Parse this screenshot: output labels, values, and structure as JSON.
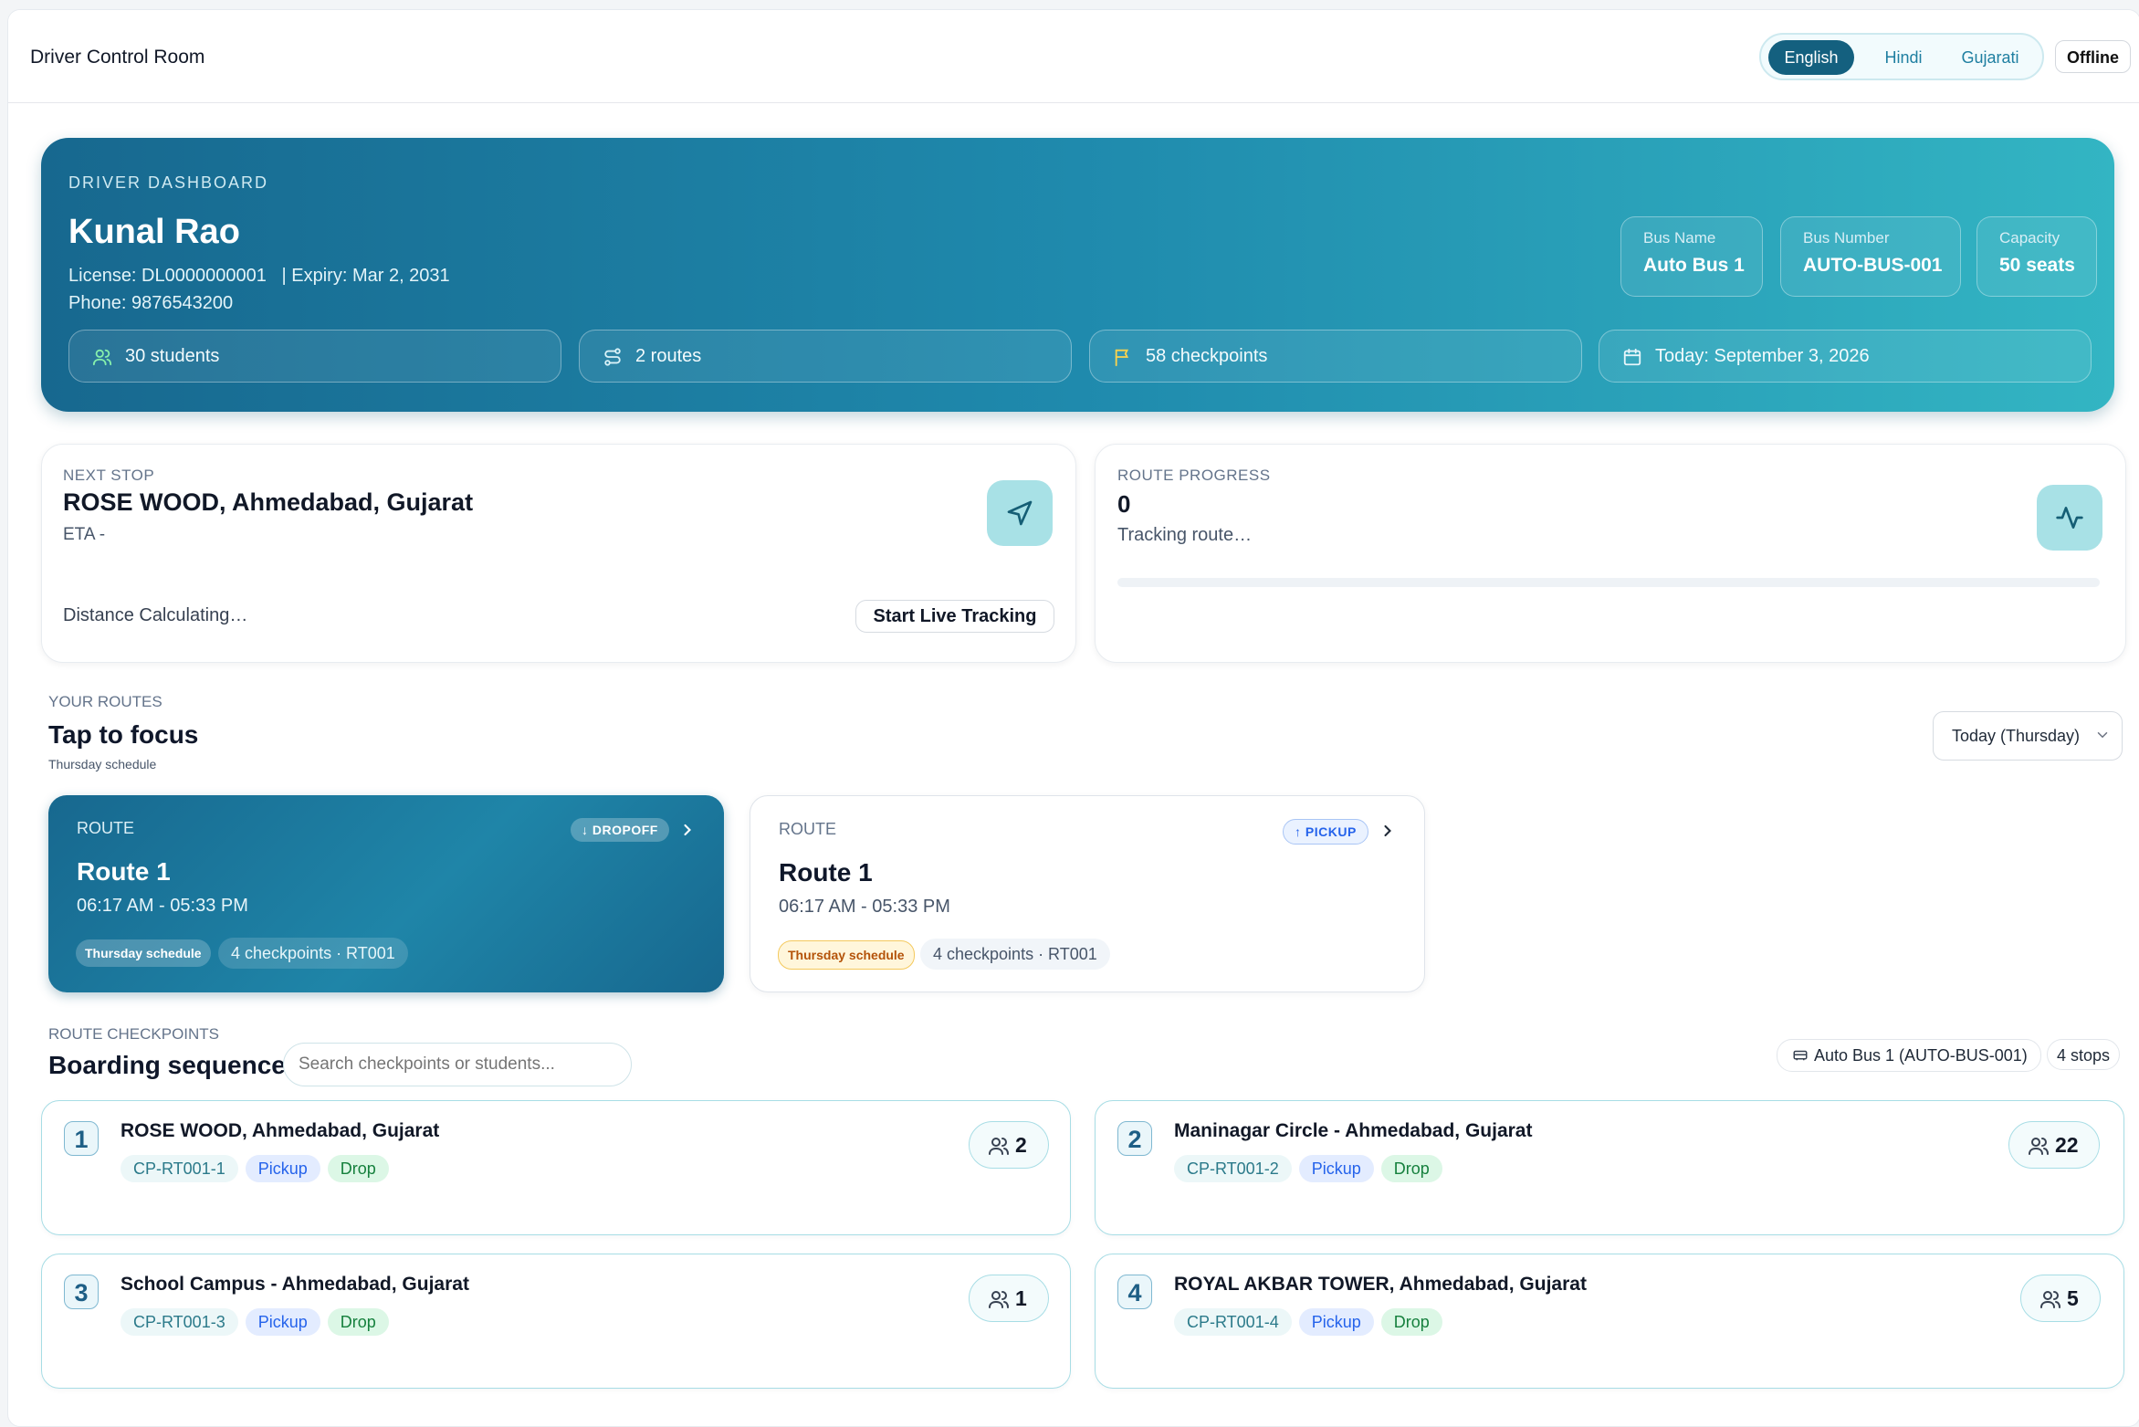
{
  "app": {
    "title": "Driver Control Room"
  },
  "languages": {
    "options": [
      "English",
      "Hindi",
      "Gujarati"
    ],
    "selected": "English"
  },
  "status": {
    "connection": "Offline"
  },
  "driver": {
    "eyebrow": "DRIVER DASHBOARD",
    "name": "Kunal Rao",
    "license_line": "License: DL0000000001   | Expiry: Mar 2, 2031",
    "phone_line": "Phone: 9876543200"
  },
  "bus": {
    "name_label": "Bus Name",
    "name": "Auto Bus 1",
    "number_label": "Bus Number",
    "number": "AUTO-BUS-001",
    "capacity_label": "Capacity",
    "capacity": "50 seats"
  },
  "stats": {
    "students": "30 students",
    "routes": "2 routes",
    "checkpoints": "58 checkpoints",
    "today": "Today: September 3, 2026"
  },
  "next_stop": {
    "label": "NEXT STOP",
    "name": "ROSE WOOD, Ahmedabad, Gujarat",
    "eta": "ETA -",
    "distance": "Distance Calculating…",
    "button": "Start Live Tracking"
  },
  "route_progress": {
    "label": "ROUTE PROGRESS",
    "value": "0",
    "status": "Tracking route…",
    "percent": 0
  },
  "routes": {
    "eyebrow": "YOUR ROUTES",
    "title": "Tap to focus",
    "subtitle": "Thursday schedule",
    "day_filter": "Today (Thursday)",
    "items": [
      {
        "label": "ROUTE",
        "tag": "↓ DROPOFF",
        "name": "Route 1",
        "time": "06:17 AM - 05:33 PM",
        "schedule": "Thursday schedule",
        "meta": "4 checkpoints · RT001",
        "active": true
      },
      {
        "label": "ROUTE",
        "tag": "↑ PICKUP",
        "name": "Route 1",
        "time": "06:17 AM - 05:33 PM",
        "schedule": "Thursday schedule",
        "meta": "4 checkpoints · RT001",
        "active": false
      }
    ]
  },
  "checkpoints": {
    "eyebrow": "ROUTE CHECKPOINTS",
    "title": "Boarding sequence",
    "search_placeholder": "Search checkpoints or students...",
    "bus_chip": "Auto Bus 1 (AUTO-BUS-001)",
    "stops_chip": "4 stops",
    "items": [
      {
        "num": "1",
        "name": "ROSE WOOD, Ahmedabad, Gujarat",
        "code": "CP-RT001-1",
        "pickup": "Pickup",
        "drop": "Drop",
        "count": "2"
      },
      {
        "num": "2",
        "name": "Maninagar Circle - Ahmedabad, Gujarat",
        "code": "CP-RT001-2",
        "pickup": "Pickup",
        "drop": "Drop",
        "count": "22"
      },
      {
        "num": "3",
        "name": "School Campus - Ahmedabad, Gujarat",
        "code": "CP-RT001-3",
        "pickup": "Pickup",
        "drop": "Drop",
        "count": "1"
      },
      {
        "num": "4",
        "name": "ROYAL AKBAR TOWER, Ahmedabad, Gujarat",
        "code": "CP-RT001-4",
        "pickup": "Pickup",
        "drop": "Drop",
        "count": "5"
      }
    ]
  },
  "colors": {
    "brand_dark": "#14607f",
    "brand_light": "#33b5c3",
    "pickup": "#2563eb",
    "drop": "#15803d"
  },
  "icons": [
    "users-icon",
    "route-icon",
    "flag-icon",
    "calendar-icon",
    "navigation-icon",
    "activity-icon",
    "chevron-down-icon",
    "chevron-right-icon",
    "bus-icon"
  ]
}
